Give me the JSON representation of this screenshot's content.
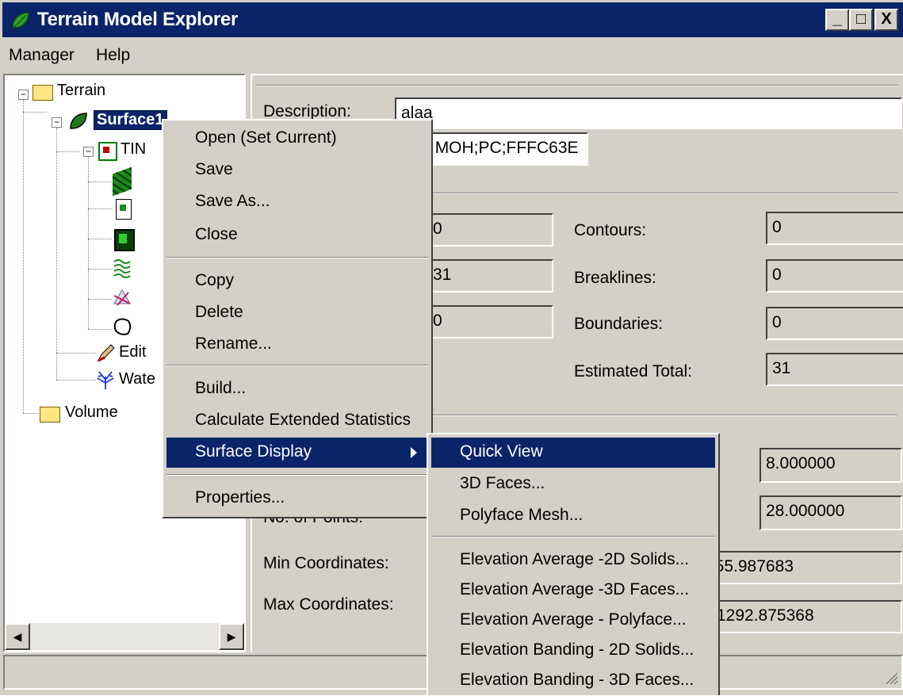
{
  "window": {
    "title": "Terrain Model Explorer",
    "controls": {
      "minimize": "_",
      "maximize": "□",
      "close": "X"
    }
  },
  "menubar": {
    "items": [
      "Manager",
      "Help"
    ]
  },
  "tree": {
    "root": "Terrain",
    "surface": "Surface1",
    "tin": "TIN",
    "edit": "Edit",
    "water": "Wate",
    "volume": "Volume",
    "icons": [
      "leaf-icon",
      "tin-icon",
      "points-icon",
      "file-icon",
      "dem-icon",
      "contours-icon",
      "breaklines-icon",
      "boundaries-icon",
      "edit-icon",
      "water-icon"
    ]
  },
  "details": {
    "description_label": "Description:",
    "description_value": "alaa",
    "layer_value": "AA MOH;PC;FFFC63E",
    "left_values": [
      "0",
      "31",
      "0"
    ],
    "contours_label": "Contours:",
    "contours_value": "0",
    "breaklines_label": "Breaklines:",
    "breaklines_value": "0",
    "boundaries_label": "Boundaries:",
    "boundaries_value": "0",
    "estimated_label": "Estimated Total:",
    "estimated_value": "31",
    "value_a": "8.000000",
    "value_b": "28.000000",
    "num_points_label": "No. of Points:",
    "min_coord_label": "Min Coordinates:",
    "min_coord_value": "555.987683",
    "max_coord_label": "Max Coordinates:",
    "max_coord_value": "1292.875368"
  },
  "context_menu": {
    "items": [
      "Open (Set Current)",
      "Save",
      "Save As...",
      "Close",
      "Copy",
      "Delete",
      "Rename...",
      "Build...",
      "Calculate Extended Statistics",
      "Surface Display",
      "Properties..."
    ],
    "selected": "Surface Display"
  },
  "submenu": {
    "items": [
      "Quick View",
      "3D Faces...",
      "Polyface Mesh...",
      "Elevation Average -2D Solids...",
      "Elevation Average -3D Faces...",
      "Elevation Average - Polyface...",
      "Elevation Banding - 2D Solids...",
      "Elevation Banding - 3D Faces..."
    ],
    "selected": "Quick View"
  },
  "colors": {
    "title_bar": "#0a246a",
    "face": "#d4d0c8",
    "highlight": "#0a246a"
  }
}
